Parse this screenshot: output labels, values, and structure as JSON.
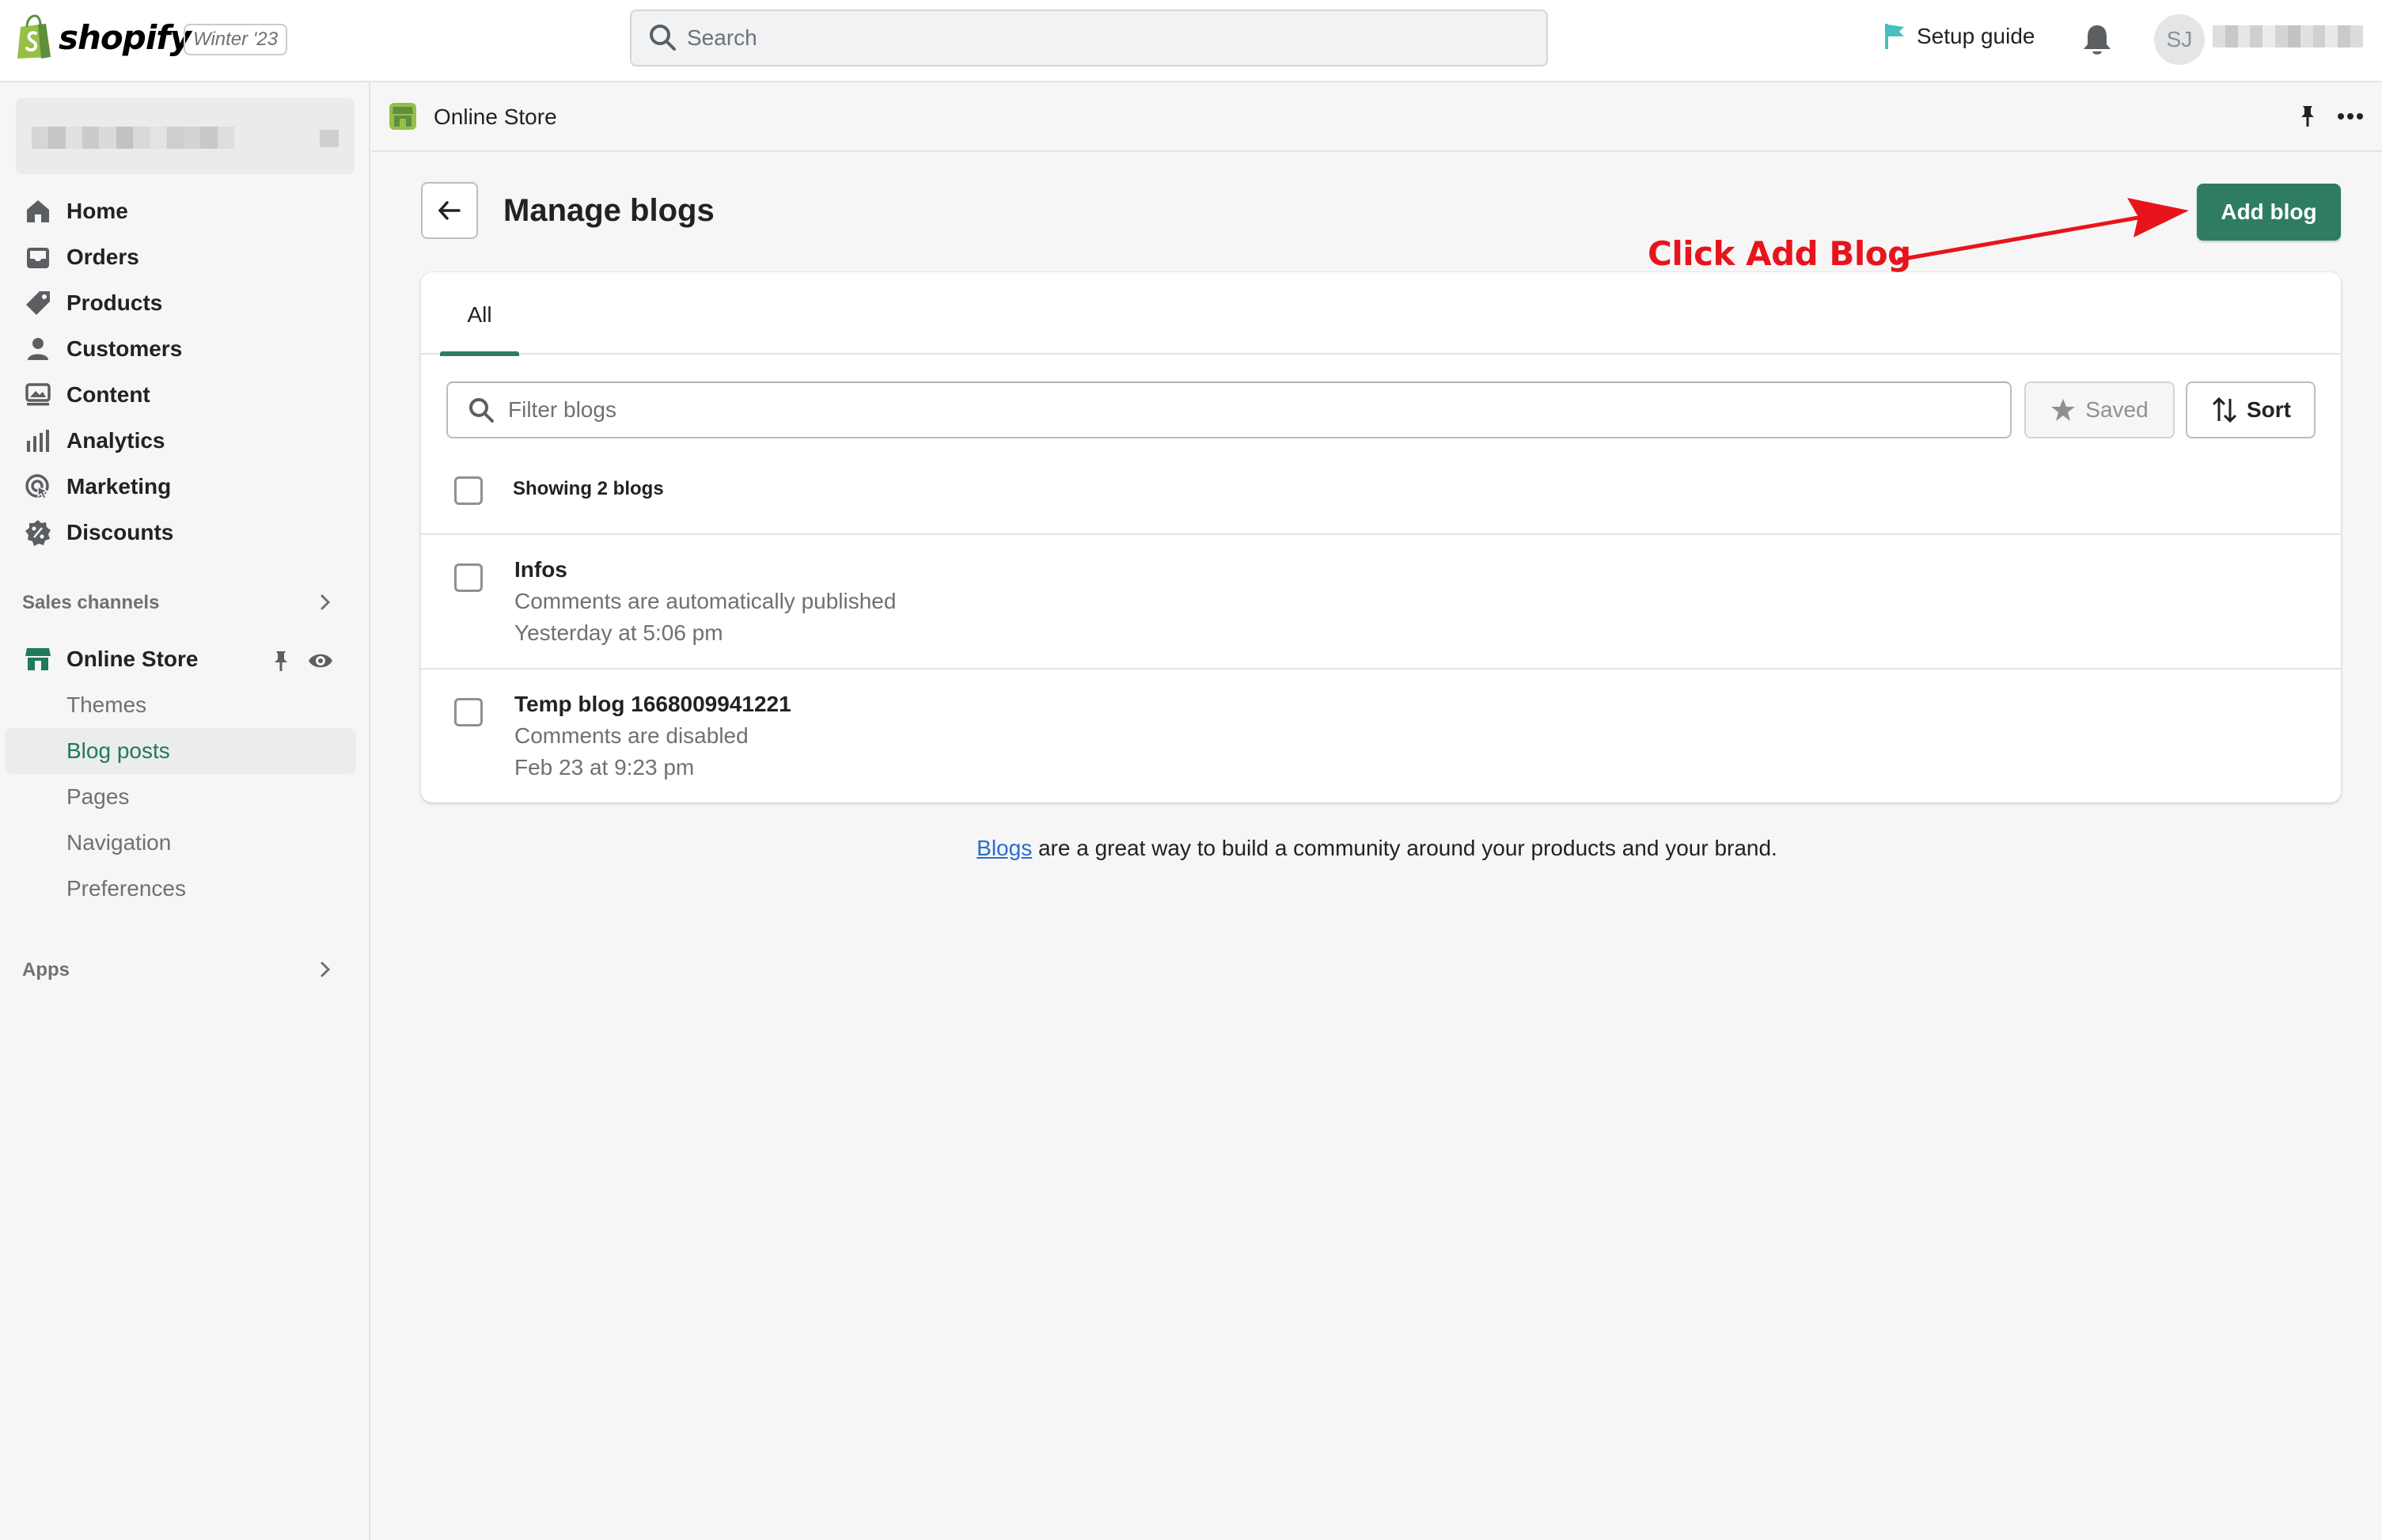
{
  "topbar": {
    "logo_text": "shopify",
    "edition": "Winter '23",
    "search_placeholder": "Search",
    "setup_guide": "Setup guide",
    "avatar_initials": "SJ",
    "colors": {
      "brand_green": "#95bf47",
      "setup_flag": "#47c1bf"
    }
  },
  "sidebar": {
    "nav": [
      {
        "label": "Home",
        "icon": "home-icon"
      },
      {
        "label": "Orders",
        "icon": "inbox-icon"
      },
      {
        "label": "Products",
        "icon": "tag-icon"
      },
      {
        "label": "Customers",
        "icon": "person-icon"
      },
      {
        "label": "Content",
        "icon": "content-icon"
      },
      {
        "label": "Analytics",
        "icon": "bar-chart-icon"
      },
      {
        "label": "Marketing",
        "icon": "target-icon"
      },
      {
        "label": "Discounts",
        "icon": "discount-icon"
      }
    ],
    "sales_channels_title": "Sales channels",
    "online_store": "Online Store",
    "online_store_sub": [
      "Themes",
      "Blog posts",
      "Pages",
      "Navigation",
      "Preferences"
    ],
    "active_sub": "Blog posts",
    "apps_title": "Apps"
  },
  "breadcrumb": {
    "label": "Online Store"
  },
  "page": {
    "title": "Manage blogs",
    "add_button": "Add blog",
    "annotation": "Click Add Blog",
    "tabs": [
      "All"
    ],
    "filter_placeholder": "Filter blogs",
    "saved_label": "Saved",
    "sort_label": "Sort",
    "showing": "Showing 2 blogs",
    "blogs": [
      {
        "title": "Infos",
        "comments": "Comments are automatically published",
        "date": "Yesterday at 5:06 pm"
      },
      {
        "title": "Temp blog 1668009941221",
        "comments": "Comments are disabled",
        "date": "Feb 23 at 9:23 pm"
      }
    ],
    "footer_link": "Blogs",
    "footer_text": " are a great way to build a community around your products and your brand.",
    "colors": {
      "primary": "#2e7d63",
      "annotation": "#e8141c",
      "link": "#2c6ecb"
    }
  }
}
